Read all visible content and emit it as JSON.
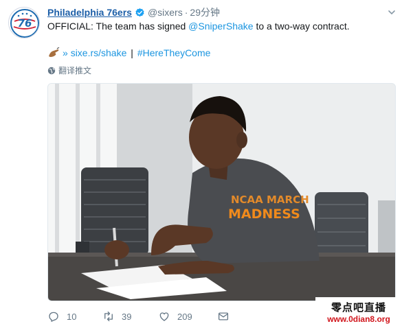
{
  "tweet": {
    "account_name": "Philadelphia 76ers",
    "handle": "@sixers",
    "separator": "·",
    "time": "29分钟",
    "text_prefix": "OFFICIAL: The team has signed ",
    "mention": "@SniperShake",
    "text_suffix": " to a two-way contract.",
    "link_prefix": "» ",
    "link_text": "sixe.rs/shake",
    "link_separator": " | ",
    "hashtag": "#HereTheyCome",
    "translate_label": "翻译推文",
    "photo_shirt_line1": "NCAA MARCH",
    "photo_shirt_line2": "MADNESS",
    "icons": {
      "avatar": "76ers-logo-icon",
      "verified": "verified-badge-icon",
      "menu": "chevron-down-icon",
      "emoji": "writing-hand-emoji-icon",
      "translate": "globe-icon"
    }
  },
  "actions": {
    "reply_count": "10",
    "retweet_count": "39",
    "like_count": "209"
  },
  "watermark": {
    "line1": "零点吧直播",
    "line2": "www.0dian8.org"
  },
  "colors": {
    "link": "#1b95e0",
    "name": "#1d5fa8",
    "muted": "#657786",
    "watermark_red": "#d1141b"
  }
}
